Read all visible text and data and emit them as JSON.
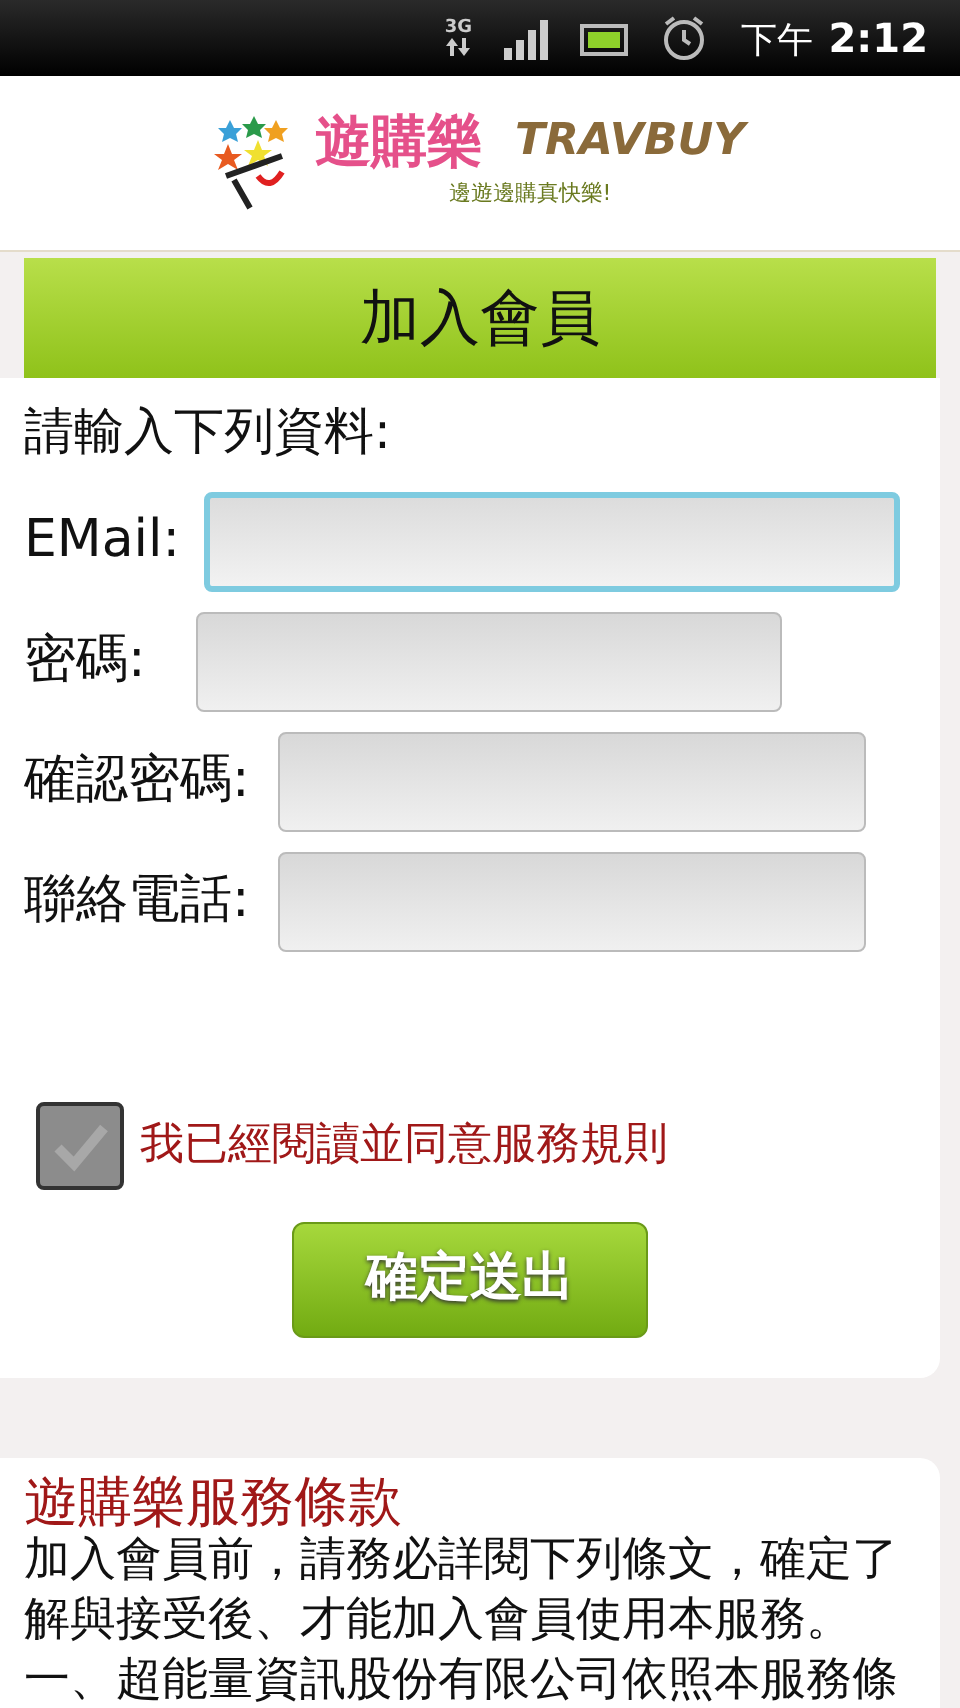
{
  "status_bar": {
    "network": "3G",
    "time_prefix": "下午",
    "time": "2:12"
  },
  "header": {
    "brand_cn": "遊購樂",
    "brand_en": "TRAVBUY",
    "slogan": "邊遊邊購真快樂!"
  },
  "form": {
    "title": "加入會員",
    "instruction": "請輸入下列資料:",
    "fields": [
      {
        "label": "EMail:",
        "focused": true
      },
      {
        "label": "密碼:",
        "focused": false
      },
      {
        "label": "確認密碼:",
        "focused": false
      },
      {
        "label": "聯絡電話:",
        "focused": false
      }
    ],
    "agree": {
      "label": "我已經閱讀並同意服務規則",
      "checked": false
    },
    "submit": "確定送出"
  },
  "terms": {
    "title": "遊購樂服務條款",
    "paragraphs": [
      "加入會員前，請務必詳閱下列條文，確定了解與接受後、才能加入會員使用本服務。",
      "一、超能量資訊股份有限公司依照本服務條"
    ]
  }
}
